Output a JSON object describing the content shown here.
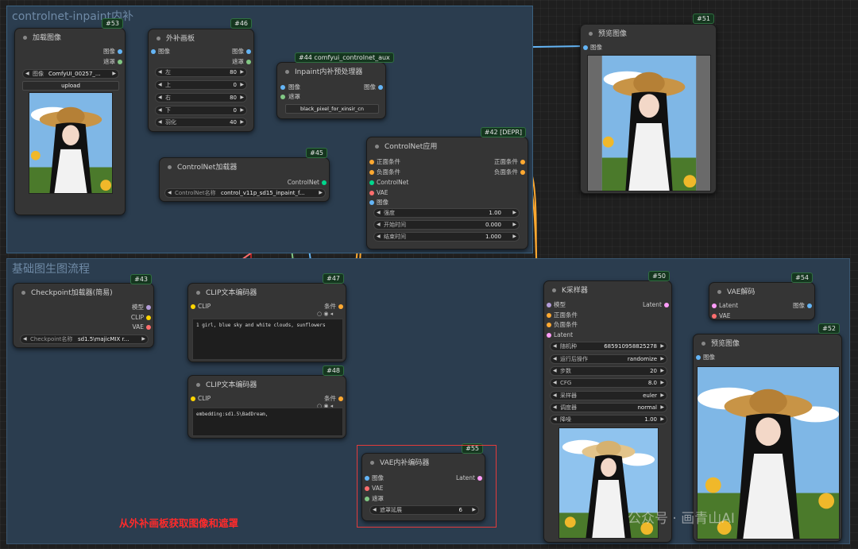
{
  "groups": {
    "inpaint": "controlnet-inpaint内补",
    "base": "基础图生图流程"
  },
  "colors": {
    "image": "#64b5f6",
    "mask": "#81c784",
    "latent": "#ff9cf9",
    "model": "#b39ddb",
    "clip": "#ffd500",
    "vae": "#ff6e6e",
    "conditioning": "#ffa931",
    "controlnet": "#00d78d"
  },
  "n53": {
    "id": "#53",
    "title": "加载图像",
    "out_image": "图像",
    "out_mask": "遮罩",
    "file_label": "图像",
    "file_value": "ComfyUI_00257_...",
    "upload": "upload"
  },
  "n46": {
    "id": "#46",
    "title": "外补画板",
    "in_image": "图像",
    "out_image": "图像",
    "out_mask": "遮罩",
    "left_l": "左",
    "left_v": "80",
    "top_l": "上",
    "top_v": "0",
    "right_l": "右",
    "right_v": "80",
    "bottom_l": "下",
    "bottom_v": "0",
    "feather_l": "羽化",
    "feather_v": "40"
  },
  "n44": {
    "id": "#44 comfyui_controlnet_aux",
    "title": "Inpaint内补预处理器",
    "in_image": "图像",
    "in_mask": "遮罩",
    "out_image": "图像",
    "button": "black_pixel_for_xinsir_cn"
  },
  "n51": {
    "id": "#51",
    "title": "预览图像",
    "in_image": "图像"
  },
  "n45": {
    "id": "#45",
    "title": "ControlNet加载器",
    "out_cn": "ControlNet",
    "w_label": "ControlNet名称",
    "w_value": "control_v11p_sd15_inpaint_f..."
  },
  "n42": {
    "id": "#42 [DEPR]",
    "title": "ControlNet应用",
    "in_pos": "正面条件",
    "in_neg": "负面条件",
    "in_cn": "ControlNet",
    "in_vae": "VAE",
    "in_image": "图像",
    "out_pos": "正面条件",
    "out_neg": "负面条件",
    "strength_l": "强度",
    "strength_v": "1.00",
    "start_l": "开始时间",
    "start_v": "0.000",
    "end_l": "结束时间",
    "end_v": "1.000"
  },
  "n43": {
    "id": "#43",
    "title": "Checkpoint加载器(简易)",
    "out_model": "模型",
    "out_clip": "CLIP",
    "out_vae": "VAE",
    "w_label": "Checkpoint名称",
    "w_value": "sd1.5\\majicMIX r..."
  },
  "n47": {
    "id": "#47",
    "title": "CLIP文本编码器",
    "in_clip": "CLIP",
    "out_cond": "条件",
    "text": "1 girl, blue sky and white clouds, sunflowers"
  },
  "n48": {
    "id": "#48",
    "title": "CLIP文本编码器",
    "in_clip": "CLIP",
    "out_cond": "条件",
    "text": "embedding:sd1.5\\BadDream,"
  },
  "n50": {
    "id": "#50",
    "title": "K采样器",
    "in_model": "模型",
    "in_pos": "正面条件",
    "in_neg": "负面条件",
    "in_latent": "Latent",
    "out_latent": "Latent",
    "seed_l": "随机种",
    "seed_v": "685910958825278",
    "ctrl_l": "运行后操作",
    "ctrl_v": "randomize",
    "steps_l": "步数",
    "steps_v": "20",
    "cfg_l": "CFG",
    "cfg_v": "8.0",
    "sampler_l": "采样器",
    "sampler_v": "euler",
    "sched_l": "调度器",
    "sched_v": "normal",
    "denoise_l": "降噪",
    "denoise_v": "1.00"
  },
  "n54": {
    "id": "#54",
    "title": "VAE解码",
    "in_latent": "Latent",
    "in_vae": "VAE",
    "out_image": "图像"
  },
  "n52": {
    "id": "#52",
    "title": "预览图像",
    "in_image": "图像"
  },
  "n55": {
    "id": "#55",
    "title": "VAE内补编码器",
    "in_image": "图像",
    "in_vae": "VAE",
    "in_mask": "遮罩",
    "out_latent": "Latent",
    "grow_l": "遮罩延展",
    "grow_v": "6"
  },
  "annotation": "从外补画板获取图像和遮罩",
  "watermark": "公众号 · 画青山AI"
}
